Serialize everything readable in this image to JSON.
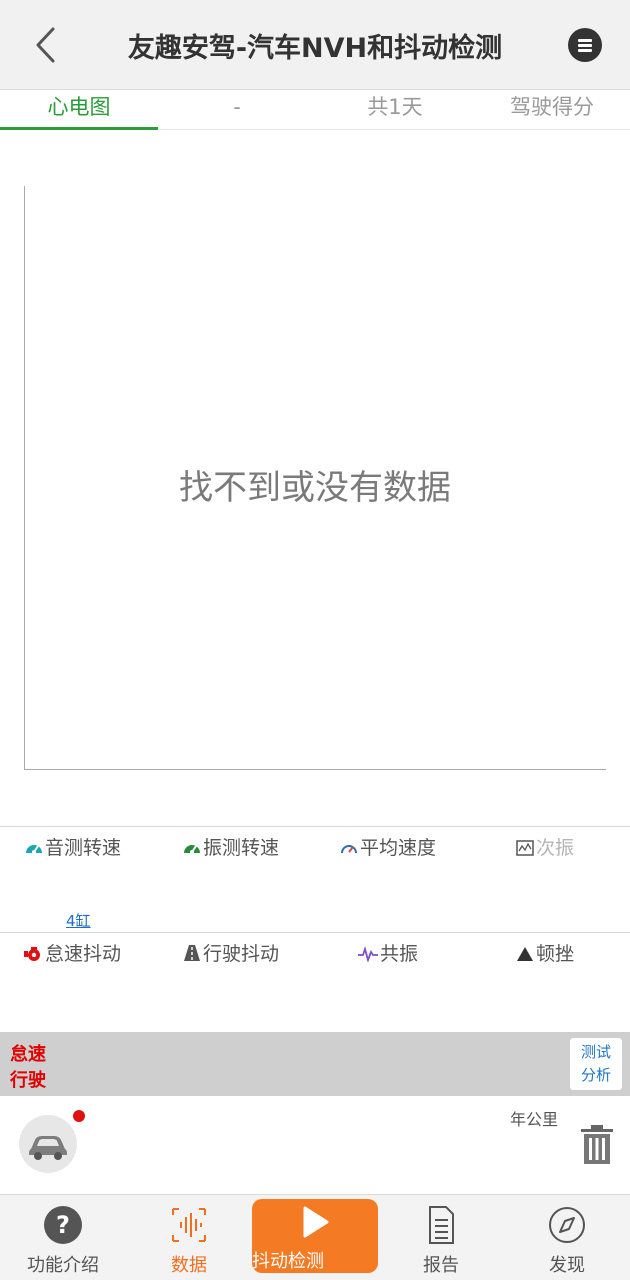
{
  "header": {
    "title": "友趣安驾-汽车NVH和抖动检测"
  },
  "tabs": [
    {
      "label": "心电图",
      "active": true
    },
    {
      "label": "-"
    },
    {
      "label": "共1天"
    },
    {
      "label": "驾驶得分"
    }
  ],
  "chart": {
    "empty_message": "找不到或没有数据"
  },
  "metrics_top": [
    {
      "label": "音测转速",
      "icon": "speedometer-icon"
    },
    {
      "label": "振测转速",
      "icon": "speedometer-icon"
    },
    {
      "label": "平均速度",
      "icon": "gauge-icon"
    },
    {
      "label": "次振",
      "icon": "chart-icon"
    }
  ],
  "cylinder_link": "4缸",
  "metrics_bottom": [
    {
      "label": "怠速抖动",
      "icon": "engine-icon"
    },
    {
      "label": "行驶抖动",
      "icon": "road-icon"
    },
    {
      "label": "共振",
      "icon": "pulse-icon"
    },
    {
      "label": "顿挫",
      "icon": "triangle-icon"
    }
  ],
  "status_bar": {
    "line1": "怠速",
    "line2": "行驶",
    "analyze_button_line1": "测试",
    "analyze_button_line2": "分析"
  },
  "vehicle": {
    "mileage_text": "年公里"
  },
  "bottom_nav": [
    {
      "label": "功能介绍",
      "icon": "help-icon"
    },
    {
      "label": "数据",
      "icon": "data-icon",
      "active": true
    },
    {
      "label": "抖动检测",
      "icon": "play-icon",
      "primary": true
    },
    {
      "label": "报告",
      "icon": "document-icon"
    },
    {
      "label": "发现",
      "icon": "compass-icon"
    }
  ],
  "colors": {
    "accent_green": "#2a9d3a",
    "accent_orange": "#f47a24",
    "alert_red": "#e00000",
    "link_blue": "#1f77c8"
  }
}
